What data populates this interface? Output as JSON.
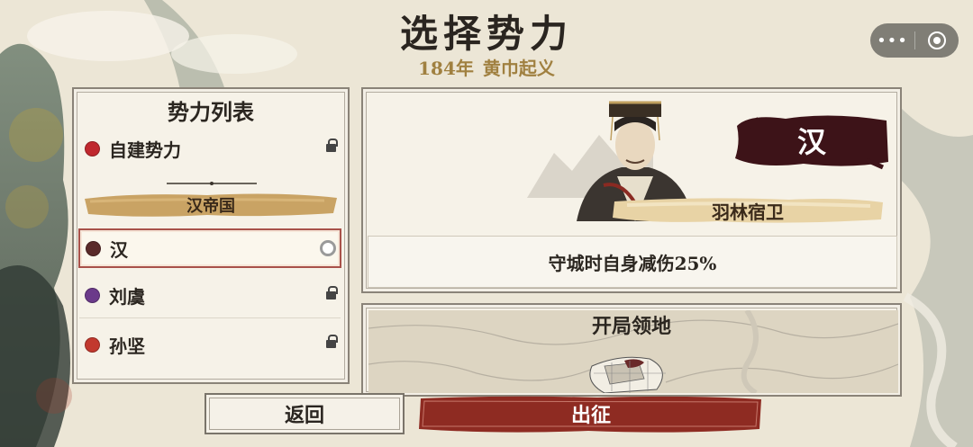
{
  "header": {
    "title": "选择势力",
    "year": "184年",
    "scenario": "黄巾起义"
  },
  "capsule": {
    "more_label": "•••",
    "icons": [
      "more-icon",
      "record-icon"
    ]
  },
  "faction_list": {
    "title": "势力列表",
    "custom": {
      "name": "自建势力",
      "color": "#c0282e",
      "locked": true
    },
    "group_label": "汉帝国",
    "items": [
      {
        "name": "汉",
        "color": "#5a2a2a",
        "selected": true,
        "locked": false
      },
      {
        "name": "刘虞",
        "color": "#6b3a8a",
        "selected": false,
        "locked": true
      },
      {
        "name": "孙坚",
        "color": "#c2392e",
        "selected": false,
        "locked": true
      }
    ]
  },
  "detail": {
    "faction_name": "汉",
    "unit_name": "羽林宿卫",
    "effect": "守城时自身减伤25%"
  },
  "territory": {
    "title": "开局领地"
  },
  "buttons": {
    "back": "返回",
    "start": "出征"
  },
  "colors": {
    "accent_red": "#8e2b22",
    "gold": "#a08040",
    "ink": "#3d1318"
  }
}
